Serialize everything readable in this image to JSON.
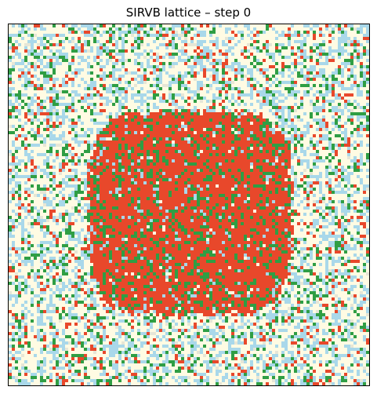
{
  "window": {
    "title": "SIRVB lattice – step 0"
  },
  "chart_data": {
    "type": "heatmap",
    "title": "SIRVB lattice – step 0",
    "xlabel": "",
    "ylabel": "",
    "grid": false,
    "axes_ticks": false,
    "legend": "none",
    "lattice": {
      "rows": 115,
      "cols": 115,
      "initial_step": 0,
      "states": [
        {
          "state": "S",
          "color": "#fffbe3"
        },
        {
          "state": "I",
          "color": "#e8482b"
        },
        {
          "state": "R",
          "color": "#2f9e44"
        },
        {
          "state": "V",
          "color": "#a9d8ea"
        },
        {
          "state": "B",
          "color": "#e6e6d6"
        }
      ],
      "background_mix": {
        "S": 0.5,
        "V": 0.28,
        "R": 0.12,
        "I": 0.08,
        "B": 0.02
      },
      "infected_core": {
        "shape": "rounded-square",
        "row_span": [
          27,
          92
        ],
        "col_span": [
          25,
          90
        ],
        "mix": {
          "I": 0.72,
          "R": 0.2,
          "V": 0.06,
          "S": 0.02
        }
      }
    }
  }
}
